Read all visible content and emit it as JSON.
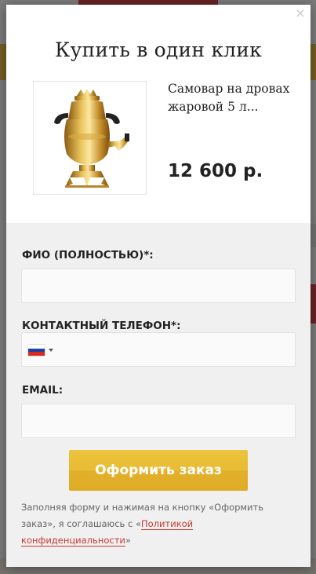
{
  "modal": {
    "close_symbol": "×",
    "title": "Купить в один клик"
  },
  "product": {
    "name": "Самовар на дровах жаровой 5 л...",
    "price": "12 600 р.",
    "image_icon": "samovar-image"
  },
  "form": {
    "name_label": "ФИО (ПОЛНОСТЬЮ)*:",
    "name_value": "",
    "phone_label": "КОНТАКТНЫЙ ТЕЛЕФОН*:",
    "phone_value": "",
    "phone_country_icon": "russia-flag-icon",
    "email_label": "EMAIL:",
    "email_value": "",
    "submit_label": "Оформить заказ",
    "agree_text_before": "Заполняя форму и нажимая на кнопку «Оформить заказ», я соглашаюсь с «",
    "agree_link": "Политикой конфиденциальности",
    "agree_text_after": "»"
  },
  "colors": {
    "button": "#e8bb33",
    "link": "#c8372d",
    "form_bg": "#f0f0f0"
  }
}
